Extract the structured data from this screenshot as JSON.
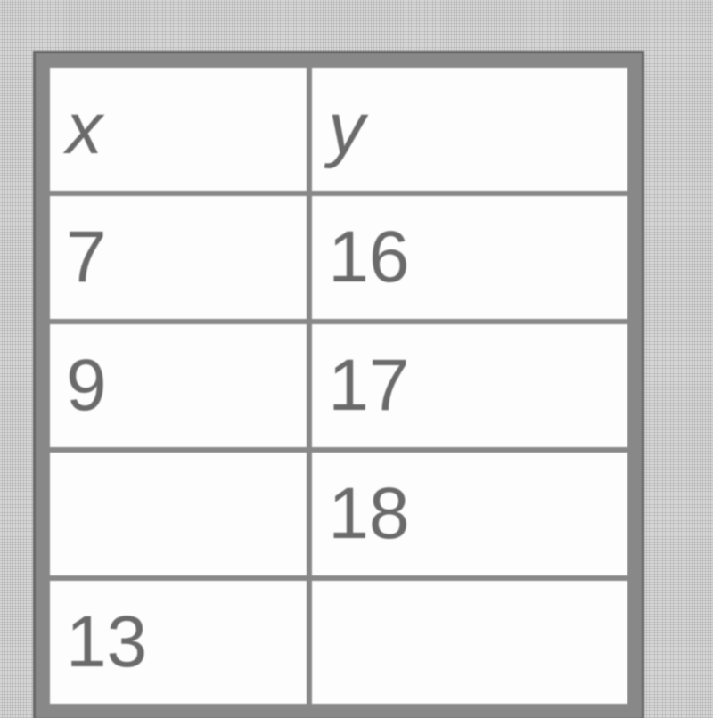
{
  "chart_data": {
    "type": "table",
    "title": "",
    "columns": [
      "x",
      "y"
    ],
    "rows": [
      {
        "x": "7",
        "y": "16"
      },
      {
        "x": "9",
        "y": "17"
      },
      {
        "x": "",
        "y": "18"
      },
      {
        "x": "13",
        "y": ""
      }
    ]
  }
}
